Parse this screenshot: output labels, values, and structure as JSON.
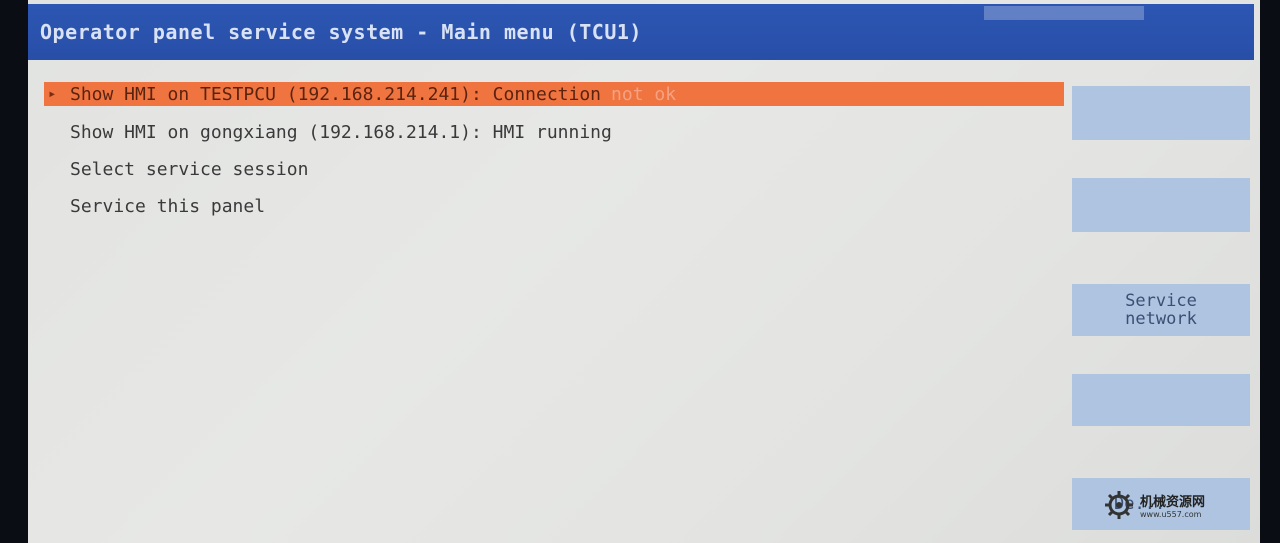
{
  "window": {
    "title": "Operator panel service system - Main menu (TCU1)"
  },
  "menu": {
    "marker": "▸",
    "items": [
      {
        "label": "Show HMI on TESTPCU (192.168.214.241): Connection",
        "status": "not ok",
        "selected": true
      },
      {
        "label": "Show HMI on gongxiang (192.168.214.1): HMI running",
        "status": "",
        "selected": false
      },
      {
        "label": "Select service session",
        "status": "",
        "selected": false
      },
      {
        "label": "Service this panel",
        "status": "",
        "selected": false
      }
    ]
  },
  "softkeys": [
    {
      "label": ""
    },
    {
      "label": ""
    },
    {
      "label": "Service\nnetwork"
    },
    {
      "label": ""
    },
    {
      "label": "De..."
    }
  ],
  "watermark": {
    "name": "机械资源网",
    "url": "www.u557.com"
  },
  "colors": {
    "title_bar": "#2a52ad",
    "selection": "#f0743f",
    "softkey": "#aec4e0",
    "warning_text": "#f4a283"
  }
}
